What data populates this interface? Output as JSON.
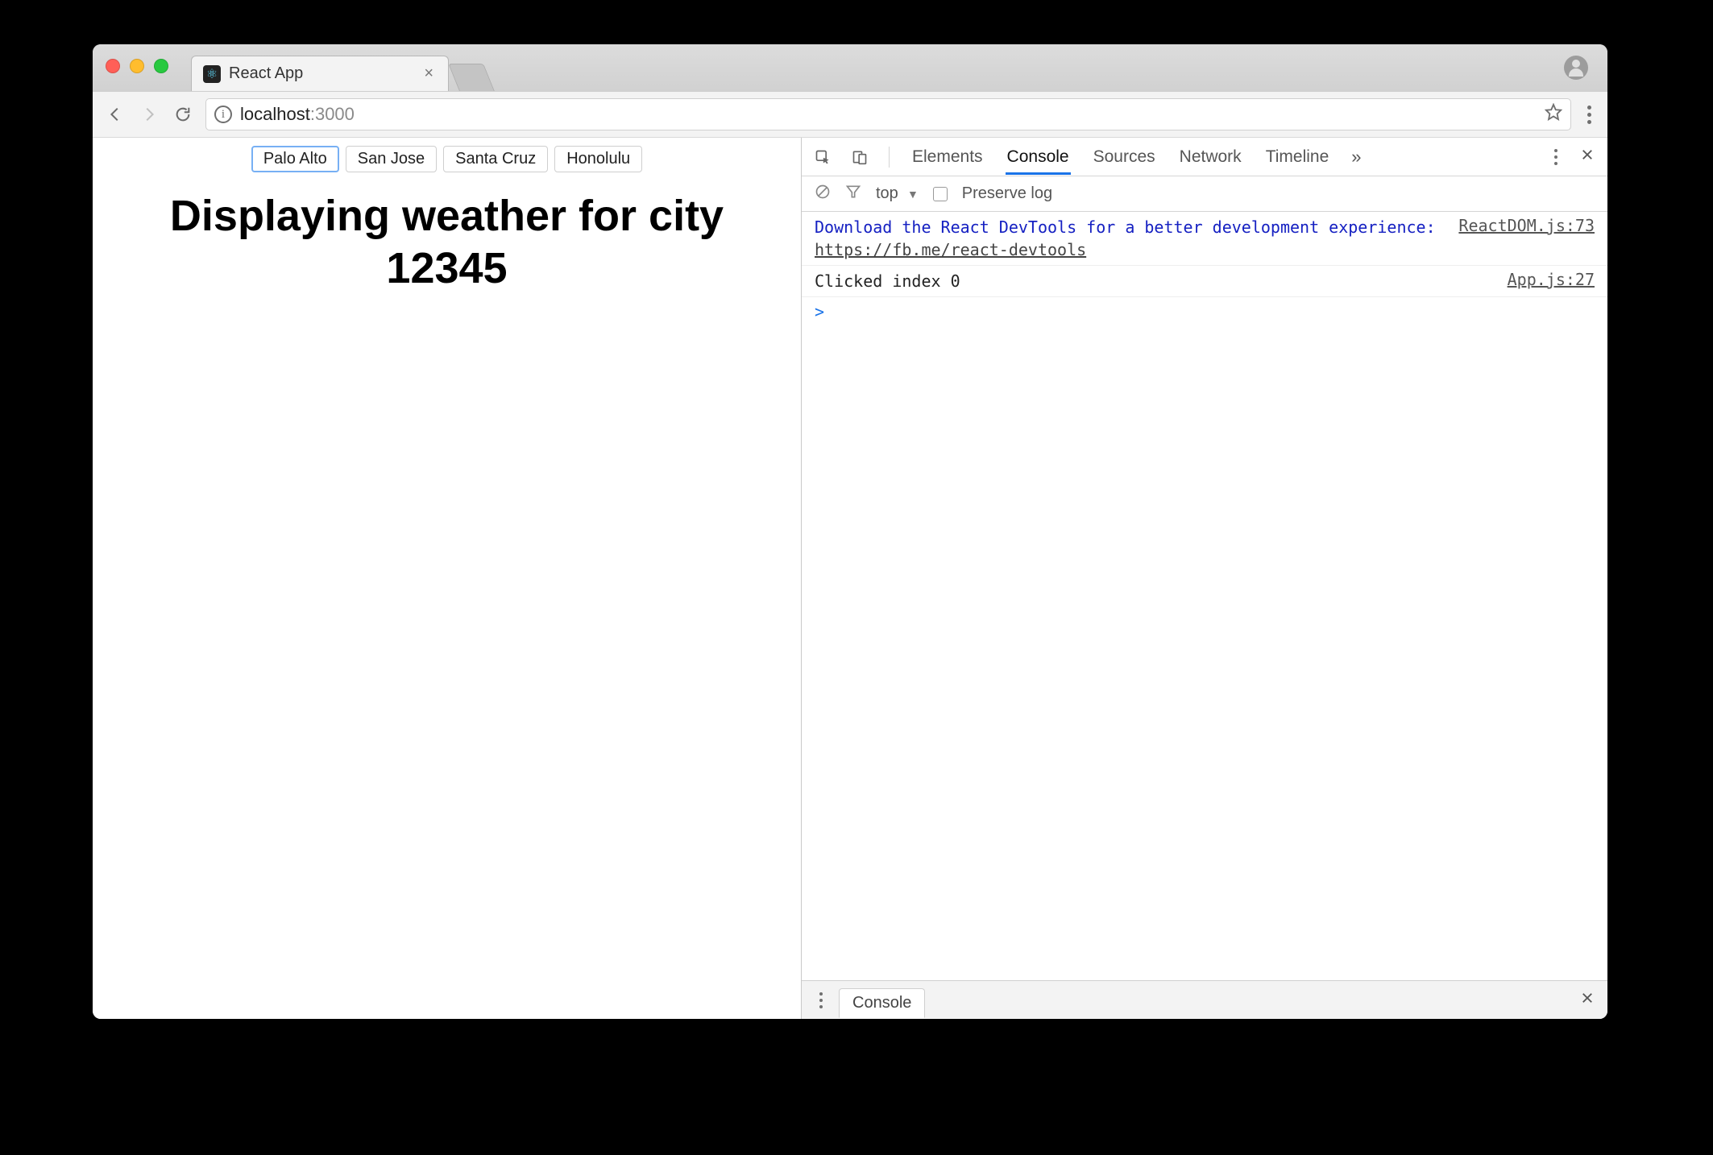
{
  "browser": {
    "tab_title": "React App",
    "url_host": "localhost",
    "url_port": ":3000"
  },
  "page": {
    "cities": [
      "Palo Alto",
      "San Jose",
      "Santa Cruz",
      "Honolulu"
    ],
    "active_city_index": 0,
    "headline": "Displaying weather for city 12345"
  },
  "devtools": {
    "tabs": [
      "Elements",
      "Console",
      "Sources",
      "Network",
      "Timeline"
    ],
    "active_tab_index": 1,
    "filter_context": "top",
    "preserve_label": "Preserve log",
    "logs": [
      {
        "type": "info",
        "text": "Download the React DevTools for a better development experience: ",
        "link": "https://fb.me/react-devtools",
        "source": "ReactDOM.js:73"
      },
      {
        "type": "plain",
        "text": "Clicked index 0",
        "source": "App.js:27"
      }
    ],
    "drawer_tab": "Console"
  }
}
